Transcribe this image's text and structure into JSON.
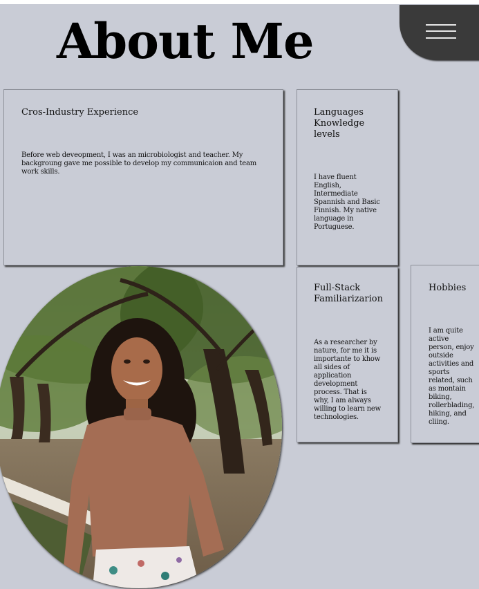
{
  "page": {
    "title": "About Me"
  },
  "menu": {
    "icon": "hamburger-menu-icon"
  },
  "cards": {
    "experience": {
      "heading": "Cros-Industry Experience",
      "body": "Before web deveopment, I was an microbiologist and teacher. My backgroung gave me possible to develop my communicaion and team work skills."
    },
    "languages": {
      "heading": "Languages Knowledge levels",
      "body": "I have fluent English, Intermediate Spannish and Basic Finnish. My native language in Portuguese."
    },
    "fullstack": {
      "heading": "Full-Stack Familiarizarion",
      "body": "As a researcher by nature, for me it is importante to khow all sides of application development process. That is why, I am always willing to learn new technologies."
    },
    "hobbies": {
      "heading": "Hobbies",
      "body": "I am quite active person, enjoy outside activities and sports related, such as montain biking, rollerblading, hiking, and cliing."
    }
  },
  "colors": {
    "background": "#c9ccd6",
    "menu": "#3a3a3a"
  }
}
